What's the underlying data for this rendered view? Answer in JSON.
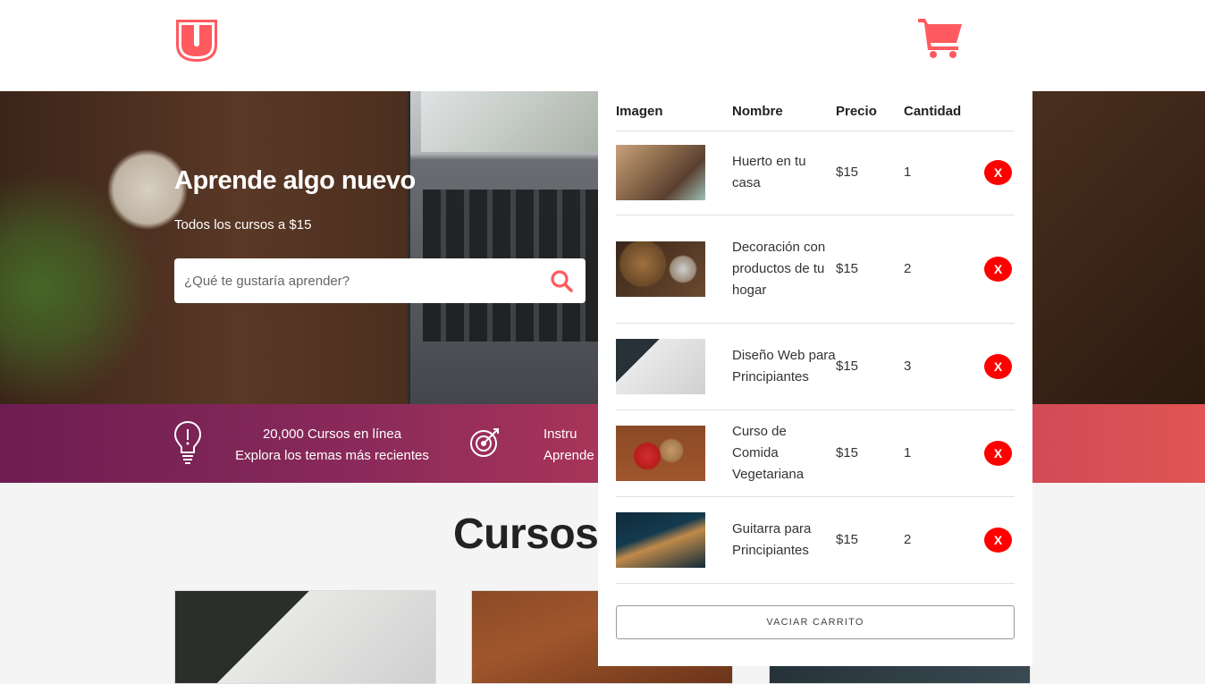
{
  "header": {
    "logo_letter": "U",
    "logo_icon": "shield-u-logo",
    "cart_icon": "shopping-cart-icon",
    "brand_color": "#ff5a5f"
  },
  "hero": {
    "title": "Aprende algo nuevo",
    "subtitle": "Todos los cursos a $15",
    "search": {
      "placeholder": "¿Qué te gustaría aprender?",
      "value": "",
      "icon": "search-icon"
    }
  },
  "info_bar": {
    "items": [
      {
        "icon": "lightbulb-icon",
        "line1": "20,000 Cursos en línea",
        "line2": "Explora los temas más recientes"
      },
      {
        "icon": "target-icon",
        "line1": "Instru",
        "line2": "Aprende"
      }
    ]
  },
  "courses": {
    "title": "Cursos"
  },
  "cart": {
    "headers": {
      "image": "Imagen",
      "name": "Nombre",
      "price": "Precio",
      "qty": "Cantidad"
    },
    "items": [
      {
        "name": "Huerto en tu casa",
        "price": "$15",
        "qty": "1",
        "remove": "X"
      },
      {
        "name": "Decoración con productos de tu hogar",
        "price": "$15",
        "qty": "2",
        "remove": "X"
      },
      {
        "name": "Diseño Web para Principiantes",
        "price": "$15",
        "qty": "3",
        "remove": "X"
      },
      {
        "name": "Curso de Comida Vegetariana",
        "price": "$15",
        "qty": "1",
        "remove": "X"
      },
      {
        "name": "Guitarra para Principiantes",
        "price": "$15",
        "qty": "2",
        "remove": "X"
      }
    ],
    "empty_button": "VACIAR CARRITO",
    "remove_color": "#ff0000"
  }
}
